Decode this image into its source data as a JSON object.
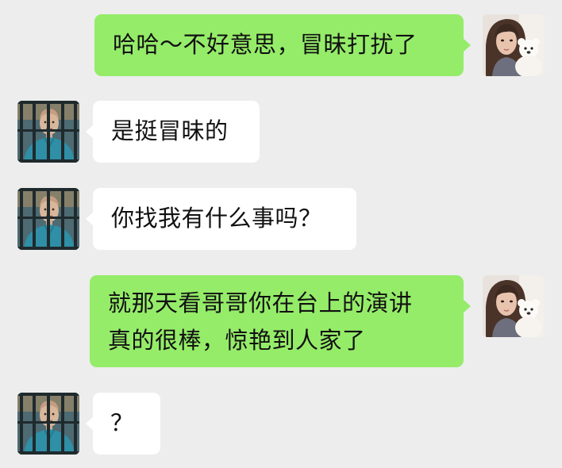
{
  "conversation": {
    "messages": [
      {
        "sender": "self",
        "avatar": "girl-with-teddy-bear-avatar",
        "text": "哈哈～不好意思，冒昧打扰了"
      },
      {
        "sender": "other",
        "avatar": "man-behind-bars-avatar",
        "text": "是挺冒昧的"
      },
      {
        "sender": "other",
        "avatar": "man-behind-bars-avatar",
        "text": "你找我有什么事吗？"
      },
      {
        "sender": "self",
        "avatar": "girl-with-teddy-bear-avatar",
        "text": "就那天看哥哥你在台上的演讲\n真的很棒，惊艳到人家了"
      },
      {
        "sender": "other",
        "avatar": "man-behind-bars-avatar",
        "text": "？"
      }
    ]
  },
  "colors": {
    "background": "#ededed",
    "self_bubble": "#95ec69",
    "other_bubble": "#ffffff"
  }
}
